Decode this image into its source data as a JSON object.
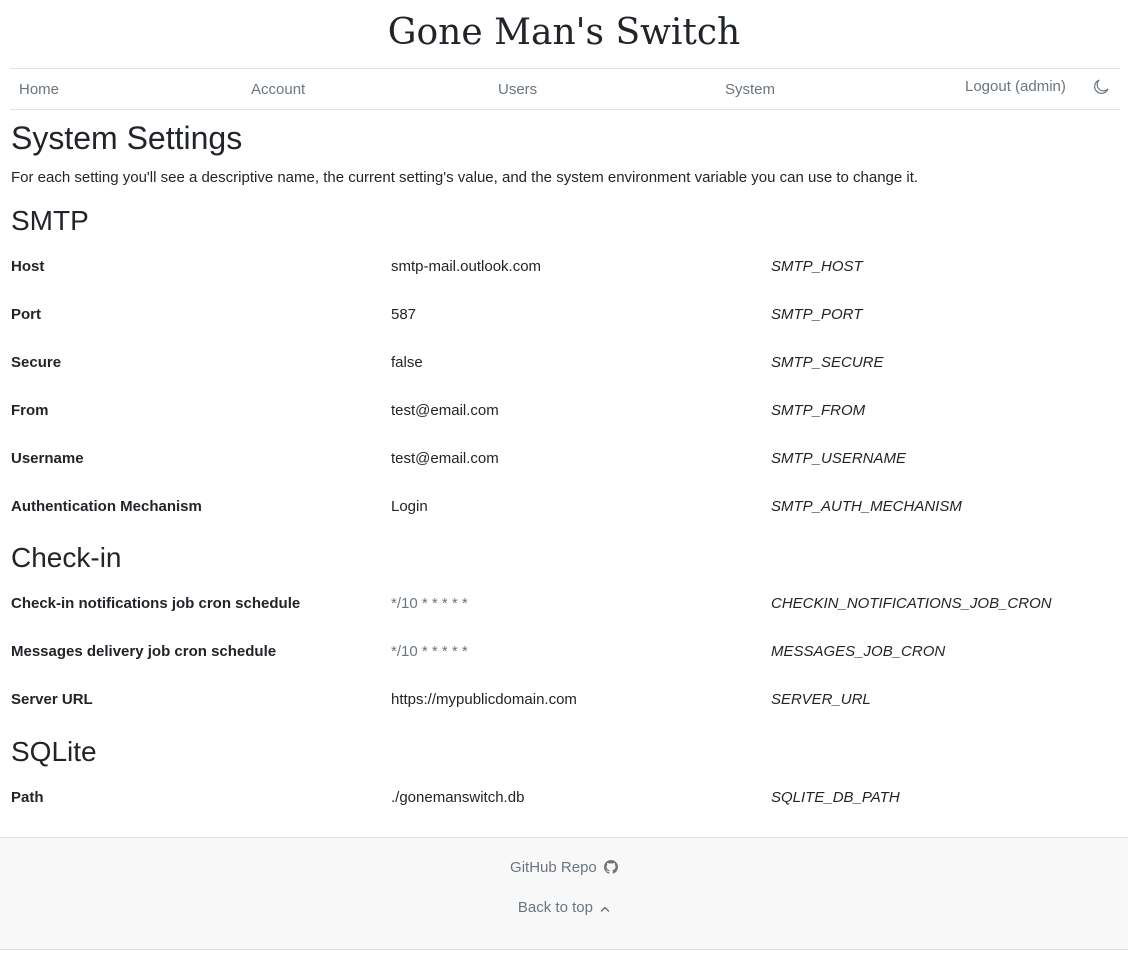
{
  "site": {
    "title": "Gone Man's Switch"
  },
  "nav": {
    "home": "Home",
    "account": "Account",
    "users": "Users",
    "system": "System",
    "logout": "Logout (admin)",
    "theme_icon": "moon-icon"
  },
  "page": {
    "title": "System Settings",
    "description": "For each setting you'll see a descriptive name, the current setting's value, and the system environment variable you can use to change it."
  },
  "sections": [
    {
      "heading": "SMTP",
      "rows": [
        {
          "name": "Host",
          "value": "smtp-mail.outlook.com",
          "env": "SMTP_HOST"
        },
        {
          "name": "Port",
          "value": "587",
          "env": "SMTP_PORT"
        },
        {
          "name": "Secure",
          "value": "false",
          "env": "SMTP_SECURE"
        },
        {
          "name": "From",
          "value": "test@email.com",
          "env": "SMTP_FROM"
        },
        {
          "name": "Username",
          "value": "test@email.com",
          "env": "SMTP_USERNAME"
        },
        {
          "name": "Authentication Mechanism",
          "value": "Login",
          "env": "SMTP_AUTH_MECHANISM"
        }
      ]
    },
    {
      "heading": "Check-in",
      "rows": [
        {
          "name": "Check-in notifications job cron schedule",
          "value": "*/10 * * * * *",
          "env": "CHECKIN_NOTIFICATIONS_JOB_CRON"
        },
        {
          "name": "Messages delivery job cron schedule",
          "value": "*/10 * * * * *",
          "env": "MESSAGES_JOB_CRON"
        },
        {
          "name": "Server URL",
          "value": "https://mypublicdomain.com",
          "env": "SERVER_URL"
        }
      ]
    },
    {
      "heading": "SQLite",
      "rows": [
        {
          "name": "Path",
          "value": "./gonemanswitch.db",
          "env": "SQLITE_DB_PATH"
        }
      ]
    }
  ],
  "footer": {
    "github_label": "GitHub Repo",
    "github_icon": "github-icon",
    "back_to_top_label": "Back to top",
    "back_to_top_icon": "chevron-up-icon"
  }
}
